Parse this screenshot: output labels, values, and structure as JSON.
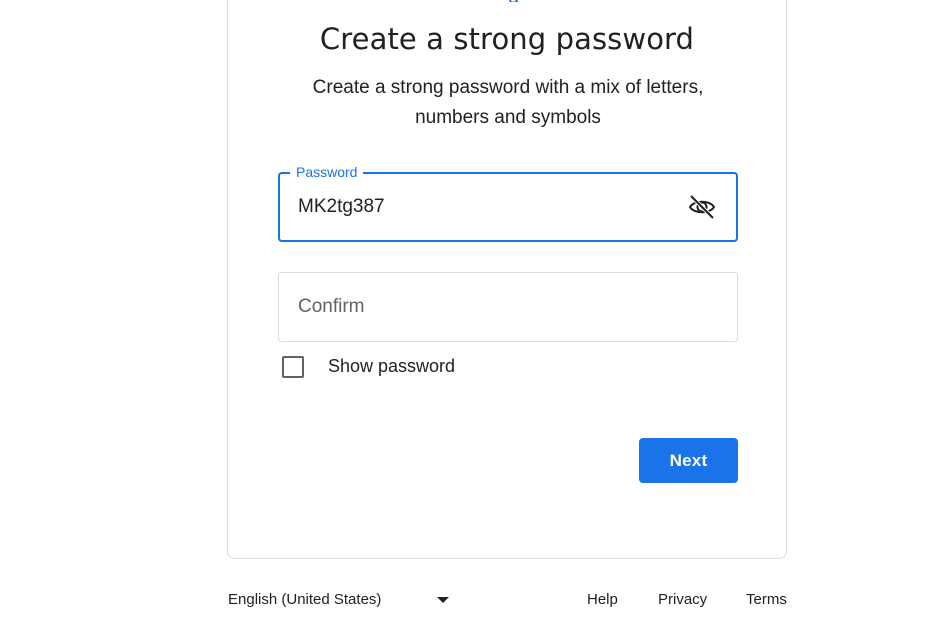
{
  "page": {
    "title": "Create a strong password",
    "subtitle": "Create a strong password with a mix of letters, numbers and symbols"
  },
  "password_field": {
    "label": "Password",
    "value": "MK2tg387",
    "visibility_icon": "eye-off-icon"
  },
  "confirm_field": {
    "placeholder": "Confirm",
    "value": ""
  },
  "show_password": {
    "label": "Show password",
    "checked": false
  },
  "actions": {
    "next_label": "Next"
  },
  "footer": {
    "language": "English (United States)",
    "links": [
      "Help",
      "Privacy",
      "Terms"
    ]
  },
  "colors": {
    "accent": "#1a73e8",
    "border": "#dadce0",
    "text": "#202124"
  }
}
